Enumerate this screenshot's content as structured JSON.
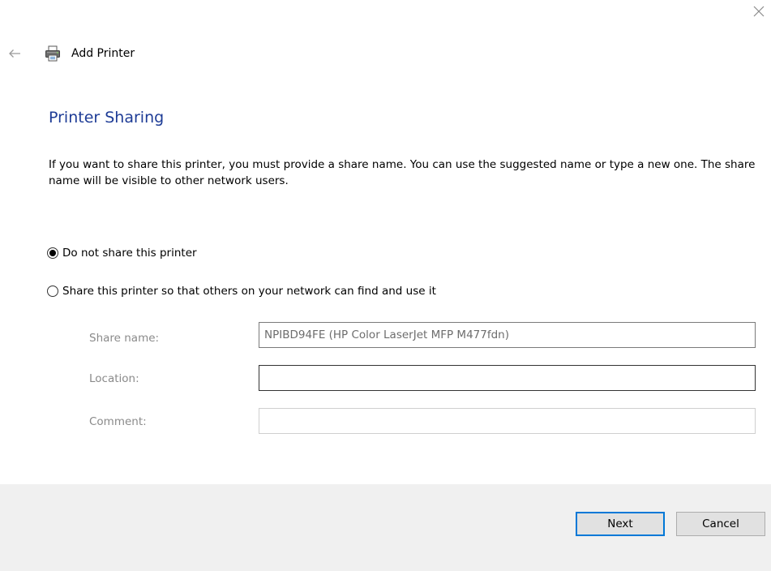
{
  "window": {
    "title": "Add Printer",
    "close_icon": "close-icon",
    "back_icon": "back-arrow-icon",
    "title_icon": "printer-icon"
  },
  "page": {
    "heading": "Printer Sharing",
    "description": "If you want to share this printer, you must provide a share name. You can use the suggested name or type a new one. The share name will be visible to other network users."
  },
  "options": {
    "no_share": {
      "label": "Do not share this printer",
      "selected": true
    },
    "share": {
      "label": "Share this printer so that others on your network can find and use it",
      "selected": false
    }
  },
  "fields": {
    "share_name": {
      "label": "Share name:",
      "value": "NPIBD94FE (HP Color LaserJet MFP M477fdn)"
    },
    "location": {
      "label": "Location:",
      "value": ""
    },
    "comment": {
      "label": "Comment:",
      "value": ""
    }
  },
  "buttons": {
    "next": "Next",
    "cancel": "Cancel"
  },
  "colors": {
    "heading": "#1e3c96",
    "focus_border": "#0078d7",
    "footer_bg": "#f0f0f0",
    "disabled_label": "#8a8a8a"
  }
}
